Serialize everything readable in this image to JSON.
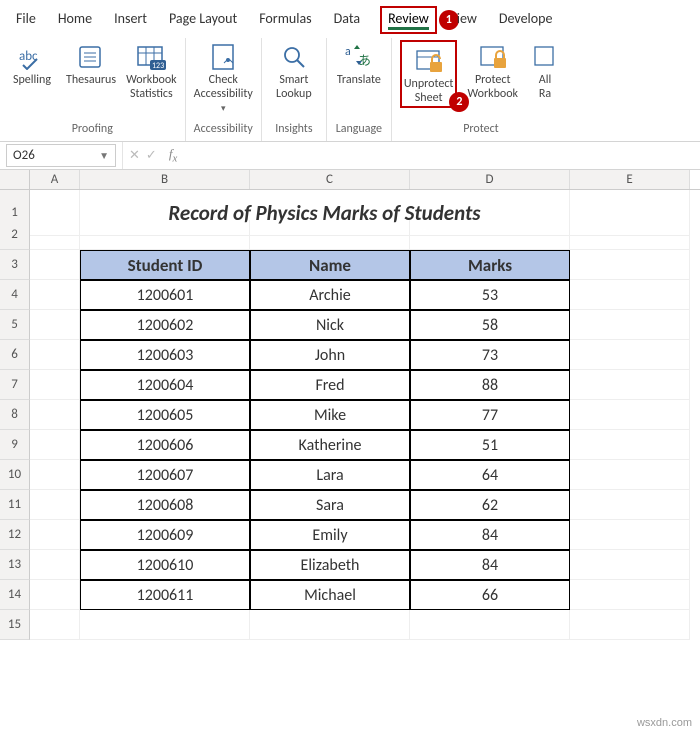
{
  "tabs": [
    "File",
    "Home",
    "Insert",
    "Page Layout",
    "Formulas",
    "Data",
    "Review",
    "iew",
    "Develope"
  ],
  "active_tab": "Review",
  "ribbon": {
    "proofing": {
      "label": "Proofing",
      "spelling": "Spelling",
      "thesaurus": "Thesaurus",
      "stats": "Workbook\nStatistics"
    },
    "accessibility": {
      "label": "Accessibility",
      "check": "Check\nAccessibility"
    },
    "insights": {
      "label": "Insights",
      "smart": "Smart\nLookup"
    },
    "language": {
      "label": "Language",
      "translate": "Translate"
    },
    "protect": {
      "label": "Protect",
      "unprotect": "Unprotect\nSheet",
      "protectwb": "Protect\nWorkbook",
      "allow": "All\nRa"
    }
  },
  "namebox": "O26",
  "columns": [
    "A",
    "B",
    "C",
    "D",
    "E"
  ],
  "title": "Record of Physics Marks of Students",
  "headers": {
    "id": "Student ID",
    "name": "Name",
    "marks": "Marks"
  },
  "rows": [
    {
      "id": "1200601",
      "name": "Archie",
      "marks": "53"
    },
    {
      "id": "1200602",
      "name": "Nick",
      "marks": "58"
    },
    {
      "id": "1200603",
      "name": "John",
      "marks": "73"
    },
    {
      "id": "1200604",
      "name": "Fred",
      "marks": "88"
    },
    {
      "id": "1200605",
      "name": "Mike",
      "marks": "77"
    },
    {
      "id": "1200606",
      "name": "Katherine",
      "marks": "51"
    },
    {
      "id": "1200607",
      "name": "Lara",
      "marks": "64"
    },
    {
      "id": "1200608",
      "name": "Sara",
      "marks": "62"
    },
    {
      "id": "1200609",
      "name": "Emily",
      "marks": "84"
    },
    {
      "id": "1200610",
      "name": "Elizabeth",
      "marks": "84"
    },
    {
      "id": "1200611",
      "name": "Michael",
      "marks": "66"
    }
  ],
  "watermark": "wsxdn.com"
}
